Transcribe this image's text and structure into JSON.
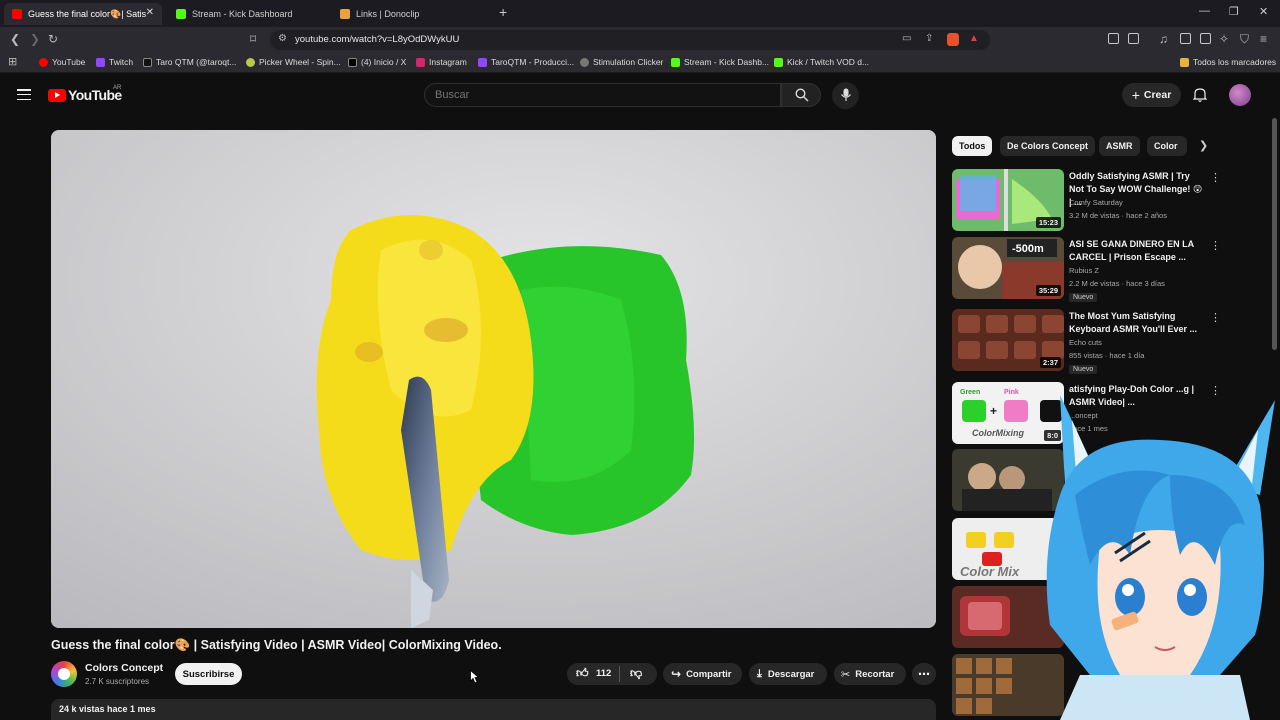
{
  "browser": {
    "tabs": [
      {
        "label": "Guess the final color🎨| Satis",
        "active": true
      },
      {
        "label": "Stream - Kick Dashboard",
        "active": false
      },
      {
        "label": "Links | Donoclip",
        "active": false
      }
    ],
    "url": "youtube.com/watch?v=L8yOdDWykUU",
    "bookmarks": [
      "YouTube",
      "Twitch",
      "Taro QTM (@taroqt...",
      "Picker Wheel - Spin...",
      "(4) Inicio / X",
      "Instagram",
      "TaroQTM - Producci...",
      "Stimulation Clicker",
      "Stream - Kick Dashb...",
      "Kick / Twitch VOD d..."
    ],
    "bookmarks_folder": "Todos los marcadores"
  },
  "header": {
    "logo_text": "YouTube",
    "region": "AR",
    "search_placeholder": "Buscar",
    "create_label": "Crear"
  },
  "video": {
    "title": "Guess the final color🎨 | Satisfying Video | ASMR Video| ColorMixing Video.",
    "channel": "Colors Concept",
    "subscribers": "2.7 K suscriptores",
    "subscribe_label": "Suscribirse",
    "likes": "112",
    "share_label": "Compartir",
    "download_label": "Descargar",
    "clip_label": "Recortar",
    "views_date": "24 k vistas  hace 1 mes"
  },
  "sidebar": {
    "chips": [
      "Todos",
      "De Colors Concept",
      "ASMR",
      "Color"
    ],
    "recommendations": [
      {
        "title": "Oddly Satisfying ASMR | Try Not To Say WOW Challenge! 😲 | ...",
        "channel": "Comfy Saturday",
        "meta": "3.2 M de vistas · hace 2 años",
        "duration": "15:23",
        "new": ""
      },
      {
        "title": "ASI SE GANA DINERO EN LA CARCEL | Prison Escape ...",
        "channel": "Rubius Z",
        "meta": "2.2 M de vistas · hace 3 días",
        "duration": "35:29",
        "new": "Nuevo"
      },
      {
        "title": "The Most Yum Satisfying Keyboard ASMR You'll Ever ...",
        "channel": "Echo cuts",
        "meta": "855 vistas · hace 1 día",
        "duration": "2:37",
        "new": "Nuevo"
      },
      {
        "title": "atisfying Play-Doh Color ...g | ASMR  Video| ...",
        "channel": "...oncept",
        "meta": "hace 1 mes",
        "duration": "8:0",
        "new": ""
      }
    ]
  },
  "colors": {
    "youtube_red": "#ff0000",
    "bg": "#0f0f0f",
    "clay_yellow": "#f5dc1a",
    "clay_green": "#2bd02b"
  }
}
